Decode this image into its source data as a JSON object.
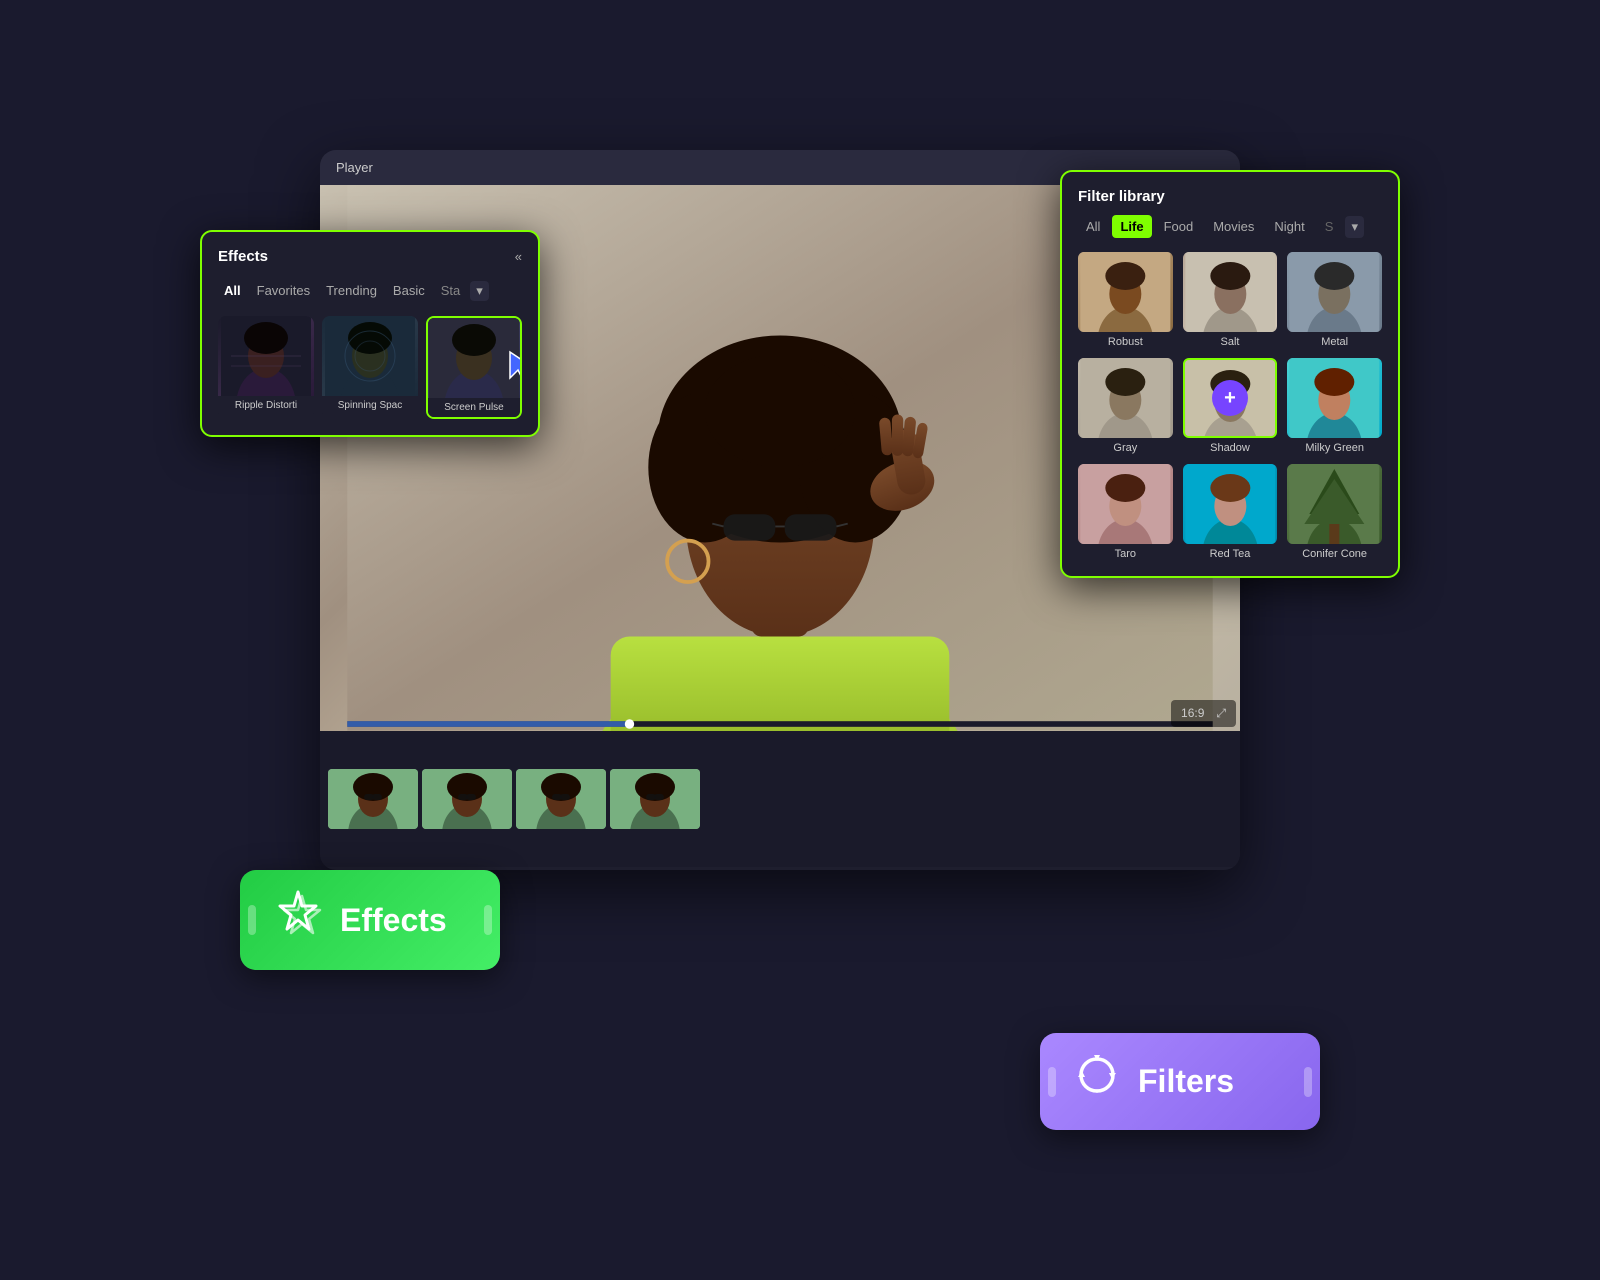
{
  "player": {
    "title": "Player",
    "ratio": "16:9",
    "expand_label": "⤢"
  },
  "effects_panel": {
    "title": "Effects",
    "collapse_icon": "«",
    "tabs": [
      {
        "id": "all",
        "label": "All",
        "active": true
      },
      {
        "id": "favorites",
        "label": "Favorites",
        "active": false
      },
      {
        "id": "trending",
        "label": "Trending",
        "active": false
      },
      {
        "id": "basic",
        "label": "Basic",
        "active": false
      },
      {
        "id": "sta",
        "label": "Sta",
        "active": false
      }
    ],
    "effects": [
      {
        "id": "ripple",
        "label": "Ripple Distorti",
        "selected": false
      },
      {
        "id": "spinning",
        "label": "Spinning Spac",
        "selected": false
      },
      {
        "id": "screen",
        "label": "Screen Pulse",
        "selected": true
      }
    ]
  },
  "filter_library": {
    "title": "Filter library",
    "tabs": [
      {
        "id": "all",
        "label": "All",
        "active": false
      },
      {
        "id": "life",
        "label": "Life",
        "active": true
      },
      {
        "id": "food",
        "label": "Food",
        "active": false
      },
      {
        "id": "movies",
        "label": "Movies",
        "active": false
      },
      {
        "id": "night",
        "label": "Night",
        "active": false
      },
      {
        "id": "s",
        "label": "S",
        "active": false
      }
    ],
    "filters": [
      {
        "id": "robust",
        "label": "Robust",
        "selected": false,
        "theme": "robust"
      },
      {
        "id": "salt",
        "label": "Salt",
        "selected": false,
        "theme": "salt"
      },
      {
        "id": "metal",
        "label": "Metal",
        "selected": false,
        "theme": "metal"
      },
      {
        "id": "gray",
        "label": "Gray",
        "selected": false,
        "theme": "gray"
      },
      {
        "id": "shadow",
        "label": "Shadow",
        "selected": true,
        "theme": "shadow",
        "has_plus": true
      },
      {
        "id": "milkygreen",
        "label": "Milky Green",
        "selected": false,
        "theme": "milkygreen"
      },
      {
        "id": "taro",
        "label": "Taro",
        "selected": false,
        "theme": "taro"
      },
      {
        "id": "redtea",
        "label": "Red Tea",
        "selected": false,
        "theme": "redtea"
      },
      {
        "id": "conifer",
        "label": "Conifer Cone",
        "selected": false,
        "theme": "conifer"
      }
    ]
  },
  "effects_badge": {
    "text": "Effects",
    "icon": "☆"
  },
  "filters_badge": {
    "text": "Filters",
    "icon": "♻"
  },
  "colors": {
    "accent_green": "#7fff00",
    "accent_purple": "#7744ff",
    "badge_green": "#33cc44",
    "badge_purple": "#9966ff"
  }
}
